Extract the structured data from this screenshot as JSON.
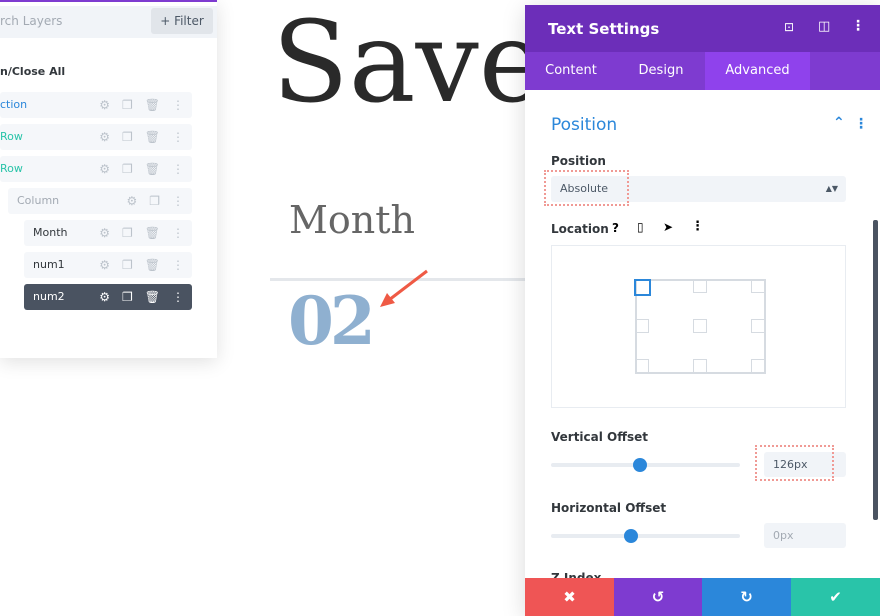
{
  "layers": {
    "search_placeholder": "rch Layers",
    "filter_label": "+ Filter",
    "open_close": "n/Close All",
    "items": [
      {
        "label": "ction",
        "color": "#2b87da"
      },
      {
        "label": "Row",
        "color": "#29c4a9"
      },
      {
        "label": "Row",
        "color": "#29c4a9"
      },
      {
        "label": "Column",
        "color": "#a3aab3"
      },
      {
        "label": "Month",
        "color": "#32373c"
      },
      {
        "label": "num1",
        "color": "#32373c"
      },
      {
        "label": "num2",
        "color": "#ffffff"
      }
    ]
  },
  "canvas": {
    "title": "Save",
    "month": "Month",
    "number": "02"
  },
  "settings": {
    "title": "Text Settings",
    "tabs": [
      "Content",
      "Design",
      "Advanced"
    ],
    "active_tab": "Advanced",
    "section": "Position",
    "position_label": "Position",
    "position_value": "Absolute",
    "location_label": "Location",
    "vertical_label": "Vertical Offset",
    "vertical_value": "126px",
    "vertical_slider": 0.47,
    "horizontal_label": "Horizontal Offset",
    "horizontal_value": "0px",
    "horizontal_slider": 0.5,
    "zindex_label": "Z Index",
    "buttons": {
      "cancel": "✖",
      "undo": "↺",
      "redo": "↻",
      "save": "✔"
    },
    "colors": {
      "header": "#6c2eb9",
      "cancel": "#ef5555",
      "undo": "#7e3bd0",
      "redo": "#2b87da",
      "save": "#29c4a9"
    }
  }
}
